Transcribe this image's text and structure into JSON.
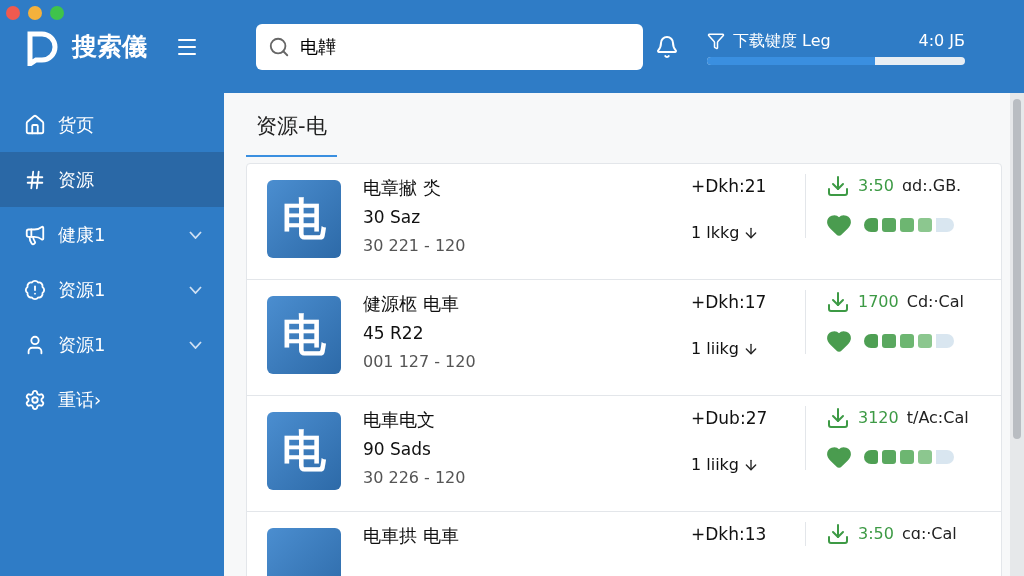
{
  "app": {
    "name": "搜索儀"
  },
  "search": {
    "value": "电韡"
  },
  "download": {
    "label": "下载键度 Leg",
    "reading": "4:0 JБ",
    "level": 0.65
  },
  "sidebar": {
    "items": [
      {
        "label": "货页",
        "selected": false,
        "expandable": false
      },
      {
        "label": "资源",
        "selected": true,
        "expandable": false
      },
      {
        "label": "健康1",
        "selected": false,
        "expandable": true
      },
      {
        "label": "资源1",
        "selected": false,
        "expandable": true
      },
      {
        "label": "资源1",
        "selected": false,
        "expandable": true
      },
      {
        "label": "重话›",
        "selected": false,
        "expandable": false
      }
    ]
  },
  "tab": {
    "label": "资源-电"
  },
  "results": [
    {
      "glyph": "电",
      "title": "电章擜 氼",
      "subtitle": "30 Saz",
      "meta": "30 221 - 120",
      "stat": "+Dkh:21",
      "size": "1 lkkg",
      "down_value": "3:50",
      "down_unit": "ɑd:.GB.",
      "level": 0.8
    },
    {
      "glyph": "电",
      "title": "健源柩 电車",
      "subtitle": "45 R22",
      "meta": "001 127 - 120",
      "stat": "+Dkh:17",
      "size": "1 liikg",
      "down_value": "1700",
      "down_unit": "Cd:·Cal",
      "level": 0.8
    },
    {
      "glyph": "电",
      "title": "电車电文",
      "subtitle": "90 Sads",
      "meta": "30 226 - 120",
      "stat": "+Dub:27",
      "size": "1 liikg",
      "down_value": "3120",
      "down_unit": "t/Ac:Cal",
      "level": 0.8
    },
    {
      "title": "电車拱 电車",
      "stat": "+Dkh:13",
      "down_value": "3:50",
      "down_unit": "cɑ:·Cal"
    }
  ]
}
